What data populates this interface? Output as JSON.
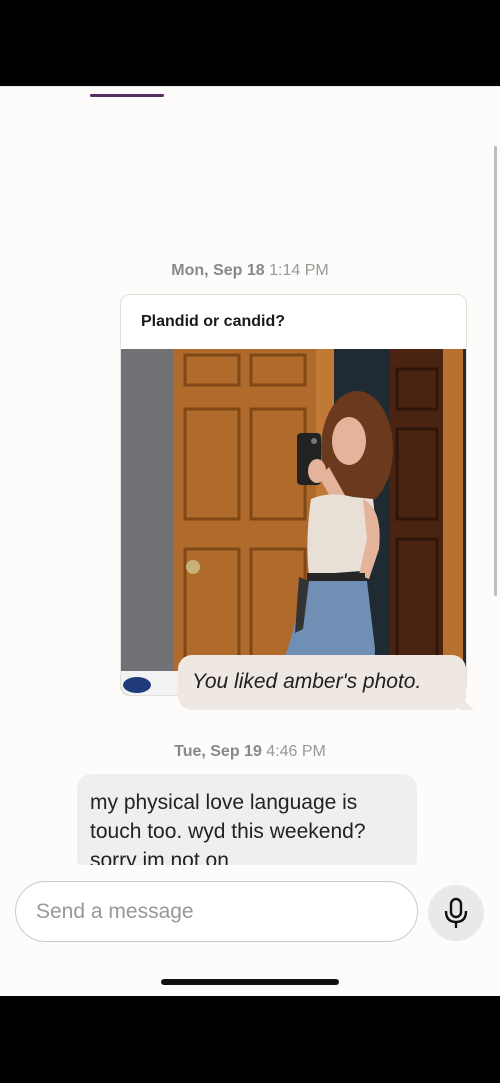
{
  "chat": {
    "day1": "Mon, Sep 18",
    "time1": "1:14 PM",
    "prompt": "Plandid or candid?",
    "liked": "You liked amber's photo.",
    "day2": "Tue, Sep 19",
    "time2": "4:46 PM",
    "message": "my physical love language is touch too. wyd this weekend? sorry im not on"
  },
  "composer": {
    "placeholder": "Send a message",
    "mic_icon": "microphone-icon"
  },
  "colors": {
    "accent": "#5a2a63",
    "liked_bubble": "#efe7e2",
    "message_bubble": "#efefef",
    "background": "#fdfcfa"
  }
}
